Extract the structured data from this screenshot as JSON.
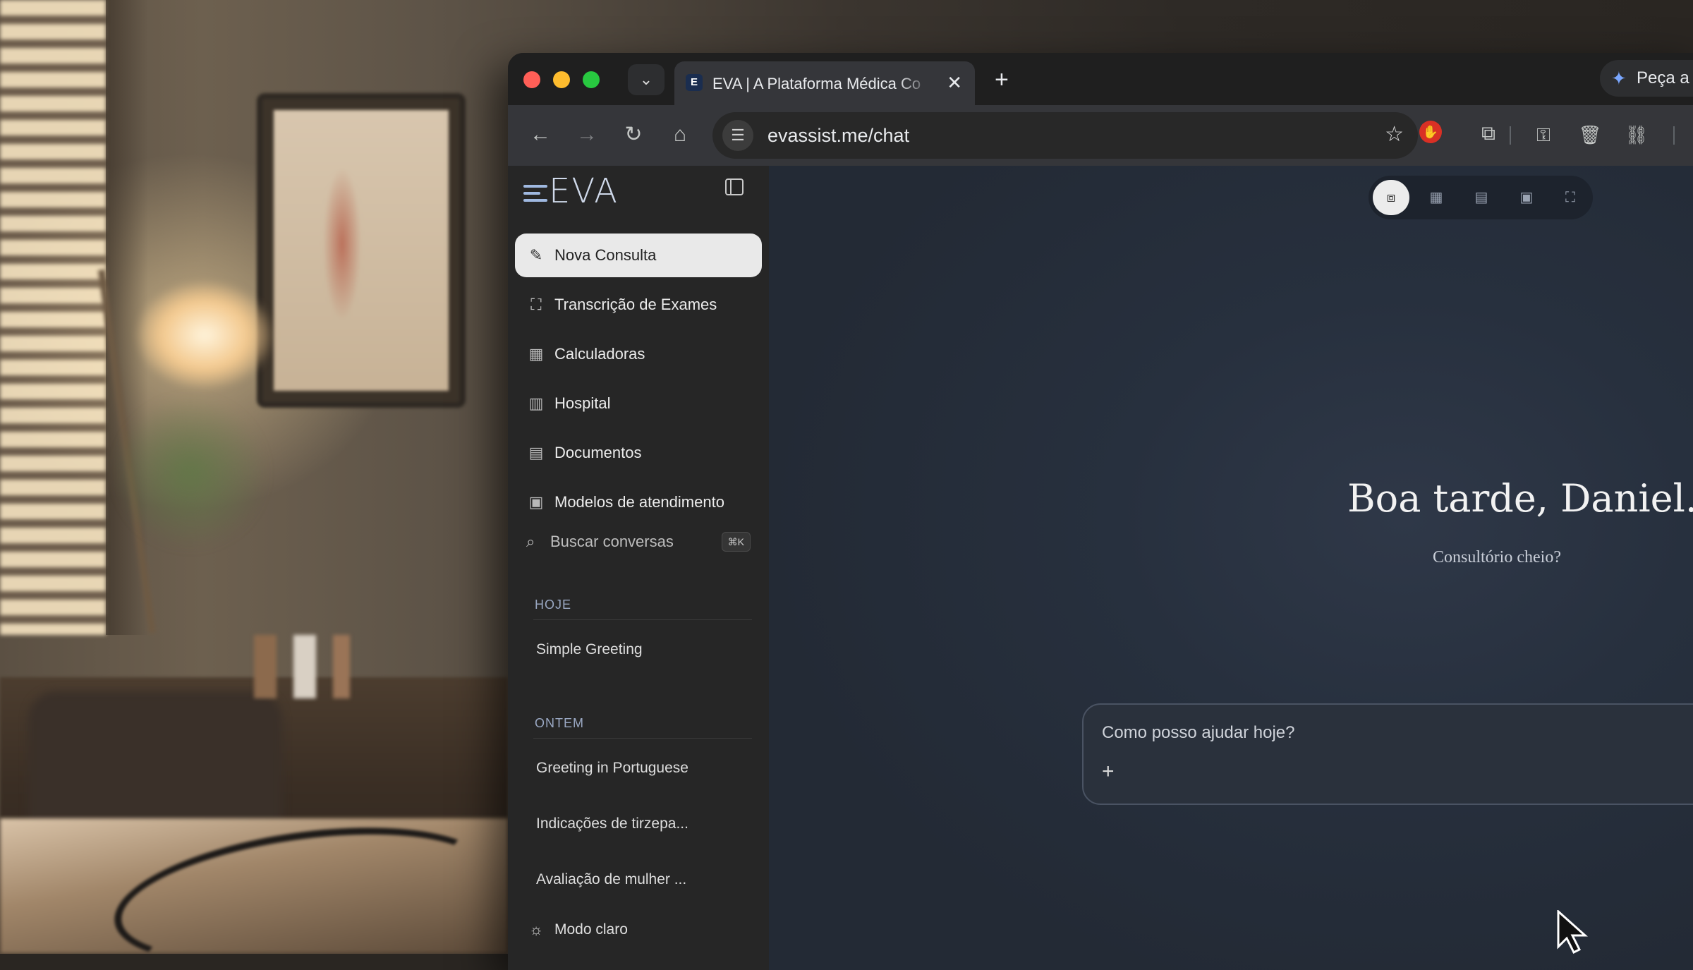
{
  "browser": {
    "tab_title": "EVA | A Plataforma Médica Co",
    "favicon_letter": "E",
    "new_tab_symbol": "+",
    "ai_button_label": "Peça a",
    "url": "evassist.me/chat",
    "icons": [
      "back-icon",
      "forward-icon",
      "reload-icon",
      "home-icon",
      "site-settings-icon",
      "star-icon",
      "extension-red-icon",
      "puzzle-icon",
      "key-icon",
      "trash-icon",
      "link-icon"
    ]
  },
  "sidebar": {
    "logo": "EVA",
    "nav": [
      {
        "label": "Nova Consulta",
        "icon": "edit-icon",
        "active": true
      },
      {
        "label": "Transcrição de Exames",
        "icon": "scan-icon",
        "active": false
      },
      {
        "label": "Calculadoras",
        "icon": "calculator-icon",
        "active": false
      },
      {
        "label": "Hospital",
        "icon": "hospital-icon",
        "active": false
      },
      {
        "label": "Documentos",
        "icon": "document-icon",
        "active": false
      },
      {
        "label": "Modelos de atendimento",
        "icon": "clipboard-icon",
        "active": false
      }
    ],
    "search": {
      "label": "Buscar conversas",
      "shortcut": "⌘K"
    },
    "sections": [
      {
        "label": "HOJE",
        "items": [
          "Simple Greeting"
        ]
      },
      {
        "label": "ONTEM",
        "items": [
          "Greeting in Portuguese",
          "Indicações de tirzepa...",
          "Avaliação de mulher ..."
        ]
      }
    ],
    "theme_toggle": "Modo claro"
  },
  "main": {
    "greeting": "Boa tarde, Daniel.",
    "subtitle": "Consultório cheio?",
    "composer_placeholder": "Como posso ajudar hoje?",
    "composer_add": "+",
    "mode_buttons": [
      "chat-icon",
      "calculator-icon",
      "document-icon",
      "clipboard-icon",
      "scan-icon"
    ]
  },
  "colors": {
    "accent": "#9fb8e0",
    "sidebar_bg": "#262626",
    "main_bg": "#27303e",
    "active_nav": "#e9e9e9"
  }
}
